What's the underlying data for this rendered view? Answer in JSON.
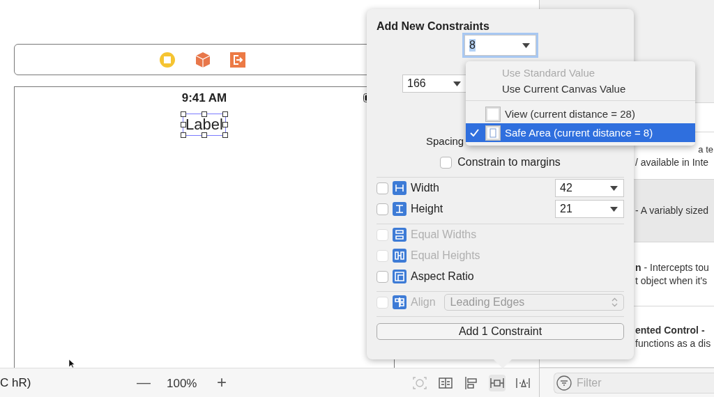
{
  "canvas": {
    "scene_icons": [
      {
        "kind": "controller"
      },
      {
        "kind": "responder"
      },
      {
        "kind": "exit"
      }
    ],
    "device": {
      "time": "9:41 AM",
      "label": {
        "text": "Label",
        "selected": true
      }
    }
  },
  "bottom_bar": {
    "device_text": "C hR)",
    "zoom_out": "—",
    "zoom": "100%",
    "zoom_in": "+",
    "tools": [
      {
        "kind": "update",
        "disabled": true,
        "active": false
      },
      {
        "kind": "embed",
        "disabled": false,
        "active": false
      },
      {
        "kind": "align",
        "disabled": false,
        "active": false
      },
      {
        "kind": "pin",
        "disabled": false,
        "active": true
      },
      {
        "kind": "resolve",
        "disabled": false,
        "active": false
      }
    ]
  },
  "popover": {
    "title": "Add New Constraints",
    "top_value": "8",
    "left_value": "166",
    "spacing_label": "Spacing",
    "margins": {
      "label": "Constrain to margins",
      "checked": false
    },
    "groups": [
      [
        {
          "label": "Width",
          "kind": "width",
          "checked": false,
          "disabled": false,
          "value": "42"
        },
        {
          "label": "Height",
          "kind": "height",
          "checked": false,
          "disabled": false,
          "value": "21"
        }
      ],
      [
        {
          "label": "Equal Widths",
          "kind": "equal-widths",
          "checked": false,
          "disabled": true
        },
        {
          "label": "Equal Heights",
          "kind": "equal-heights",
          "checked": false,
          "disabled": true
        },
        {
          "label": "Aspect Ratio",
          "kind": "aspect",
          "checked": false,
          "disabled": false
        }
      ],
      [
        {
          "label": "Align",
          "kind": "align",
          "checked": false,
          "disabled": true,
          "select": "Leading Edges"
        }
      ]
    ],
    "button": "Add 1 Constraint"
  },
  "menu": {
    "groups": [
      [
        {
          "label": "Use Standard Value",
          "kind": "plain",
          "disabled": true,
          "selected": false
        },
        {
          "label": "Use Current Canvas Value",
          "kind": "plain",
          "disabled": false,
          "selected": false
        }
      ],
      [
        {
          "label": "View (current distance = 28)",
          "kind": "view",
          "disabled": false,
          "selected": false
        },
        {
          "label": "Safe Area (current distance = 8)",
          "kind": "safe-area",
          "disabled": false,
          "selected": true
        }
      ]
    ]
  },
  "library": {
    "rows": [
      {
        "selected": false
      },
      {
        "selected": false,
        "lines": [
          {
            "kind": "tail",
            "text": "a te"
          },
          {
            "kind": "text",
            "text": "/ available in Inte"
          }
        ]
      },
      {
        "selected": true,
        "lines": [
          {
            "kind": "text",
            "text": "- A variably sized"
          }
        ]
      },
      {
        "selected": false,
        "lines": [
          {
            "kind": "text",
            "text": "**n** - Intercepts tou"
          },
          {
            "kind": "text",
            "text": "t object when it's"
          }
        ]
      },
      {
        "selected": false,
        "lines": [
          {
            "kind": "title",
            "text": "ented Control -"
          },
          {
            "kind": "text",
            "text": "functions as a dis"
          }
        ]
      }
    ],
    "filter_placeholder": "Filter"
  }
}
